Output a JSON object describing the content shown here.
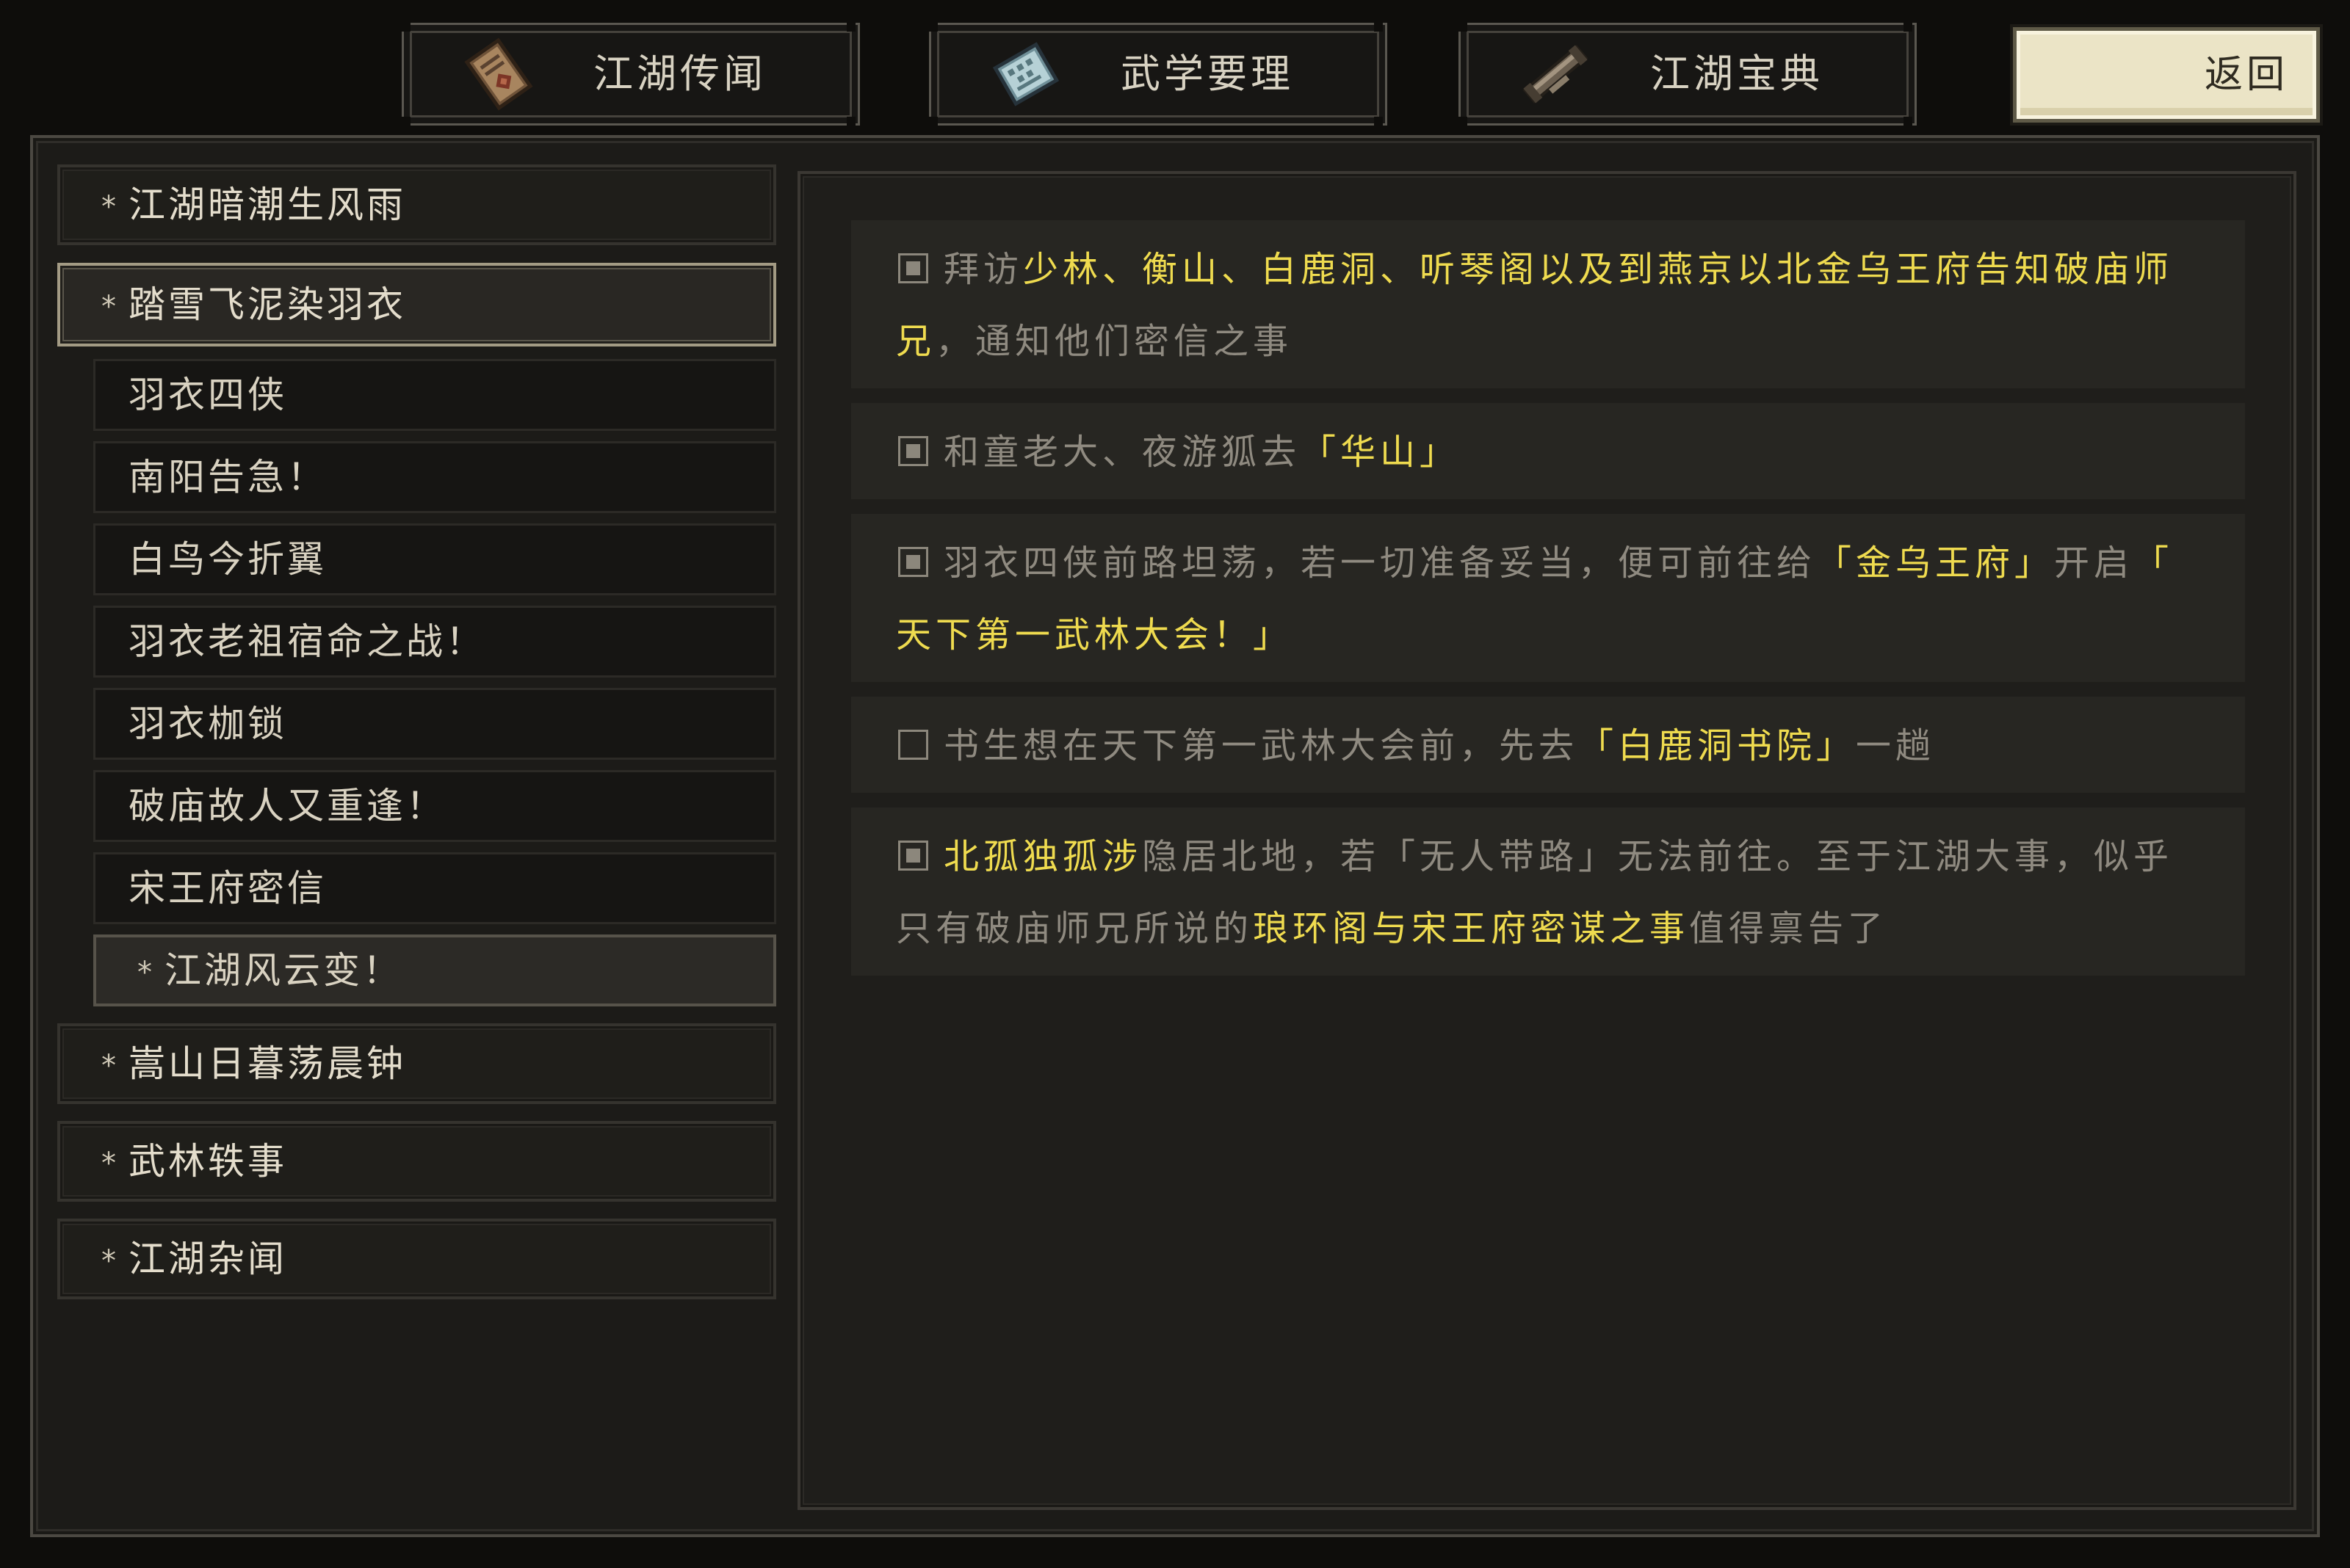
{
  "tabs": [
    {
      "label": "江湖传闻",
      "icon": "scroll-letter-icon"
    },
    {
      "label": "武学要理",
      "icon": "martial-manual-icon"
    },
    {
      "label": "江湖宝典",
      "icon": "rolled-scroll-icon"
    }
  ],
  "back_button": {
    "label": "返回"
  },
  "chapters": [
    {
      "label": "江湖暗潮生风雨",
      "selected": false
    },
    {
      "label": "踏雪飞泥染羽衣",
      "selected": true,
      "expanded": true,
      "quests": [
        {
          "label": "羽衣四侠",
          "active": false
        },
        {
          "label": "南阳告急！",
          "active": false
        },
        {
          "label": "白鸟今折翼",
          "active": false
        },
        {
          "label": "羽衣老祖宿命之战！",
          "active": false
        },
        {
          "label": "羽衣枷锁",
          "active": false
        },
        {
          "label": "破庙故人又重逢！",
          "active": false
        },
        {
          "label": "宋王府密信",
          "active": false
        },
        {
          "label": "江湖风云变！",
          "active": true
        }
      ]
    },
    {
      "label": "嵩山日暮荡晨钟",
      "selected": false
    },
    {
      "label": "武林轶事",
      "selected": false
    },
    {
      "label": "江湖杂闻",
      "selected": false
    }
  ],
  "objectives": [
    {
      "completed": true,
      "segments": [
        {
          "text": "拜访",
          "highlight": false
        },
        {
          "text": "少林、衡山、白鹿洞、听琴阁以及到燕京以北金乌王府告知破庙师兄",
          "highlight": true
        },
        {
          "text": "，通知他们密信之事",
          "highlight": false
        }
      ]
    },
    {
      "completed": true,
      "segments": [
        {
          "text": "和童老大、夜游狐去",
          "highlight": false
        },
        {
          "text": "「华山」",
          "highlight": true
        }
      ]
    },
    {
      "completed": true,
      "segments": [
        {
          "text": "羽衣四侠前路坦荡，若一切准备妥当，便可前往给",
          "highlight": false
        },
        {
          "text": "「金乌王府」",
          "highlight": true
        },
        {
          "text": "开启",
          "highlight": false
        },
        {
          "text": "「天下第一武林大会！」",
          "highlight": true
        }
      ]
    },
    {
      "completed": false,
      "segments": [
        {
          "text": "书生想在天下第一武林大会前，先去",
          "highlight": false
        },
        {
          "text": "「白鹿洞书院」",
          "highlight": true
        },
        {
          "text": "一趟",
          "highlight": false
        }
      ]
    },
    {
      "completed": true,
      "segments": [
        {
          "text": "北孤独孤涉",
          "highlight": true
        },
        {
          "text": "隐居北地，若「无人带路」无法前往。至于江湖大事，似乎只有破庙师兄所说的",
          "highlight": false
        },
        {
          "text": "琅环阁与宋王府密谋之事",
          "highlight": true
        },
        {
          "text": "值得禀告了",
          "highlight": false
        }
      ]
    }
  ],
  "colors": {
    "highlight": "#efdb4f",
    "text_dim": "#8f8a80",
    "text_light": "#e4ddcc",
    "back_button_bg": "#ebe4c6"
  }
}
